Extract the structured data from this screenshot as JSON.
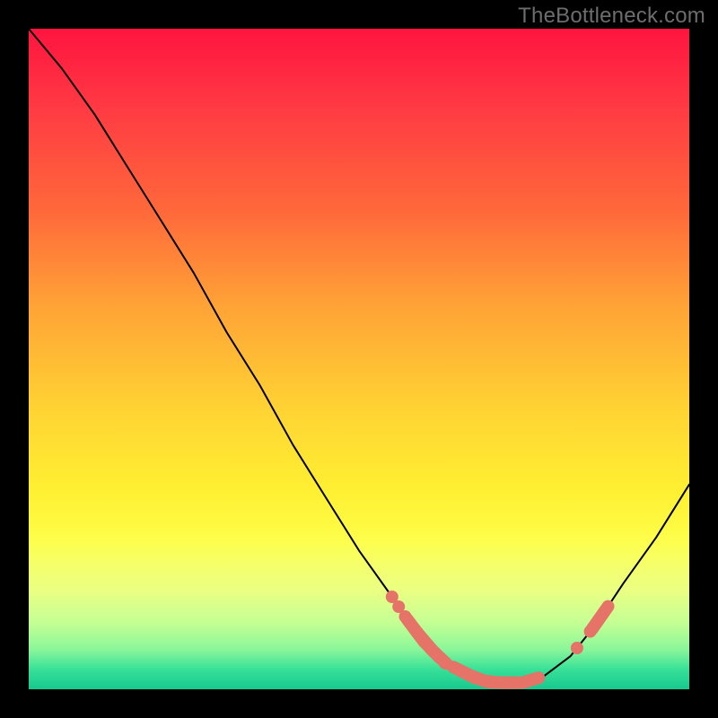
{
  "attribution": "TheBottleneck.com",
  "colors": {
    "background": "#000000",
    "marker": "#e57368",
    "curve": "#000000",
    "gradient_stops": [
      "#ff143f",
      "#ff6a3a",
      "#ffd433",
      "#fdff4a",
      "#2ddf93"
    ]
  },
  "chart_data": {
    "type": "line",
    "title": "",
    "xlabel": "",
    "ylabel": "",
    "xlim": [
      0,
      100
    ],
    "ylim": [
      0,
      100
    ],
    "x": [
      0,
      5,
      10,
      15,
      20,
      25,
      30,
      35,
      40,
      45,
      50,
      55,
      57,
      60,
      63,
      65,
      68,
      70,
      72,
      75,
      78,
      82,
      86,
      90,
      95,
      100
    ],
    "y": [
      100,
      94,
      87,
      79,
      71,
      63,
      54,
      46,
      37,
      29,
      21,
      14,
      11,
      7,
      4,
      3,
      1.5,
      1,
      1,
      1,
      2,
      5,
      10,
      16,
      23,
      31
    ],
    "markers": {
      "note": "Coral overlay dots/pills along the curve; x positions in percent, shape radius implied by fill style",
      "points_x": [
        55,
        56,
        57,
        58.5,
        60,
        61,
        62,
        63,
        65.5,
        66.5,
        68,
        70,
        71,
        73,
        76,
        83,
        85,
        86.5
      ],
      "clusters": [
        {
          "style": "dot",
          "x": [
            55,
            56,
            57
          ]
        },
        {
          "style": "pill",
          "x": [
            58.5,
            60,
            61,
            62
          ]
        },
        {
          "style": "dot",
          "x": [
            63
          ]
        },
        {
          "style": "pill",
          "x": [
            65.5,
            66.5
          ]
        },
        {
          "style": "pill",
          "x": [
            68,
            70,
            71,
            73,
            76
          ]
        },
        {
          "style": "dot",
          "x": [
            83,
            85
          ]
        },
        {
          "style": "pill",
          "x": [
            86.5
          ]
        }
      ]
    }
  }
}
